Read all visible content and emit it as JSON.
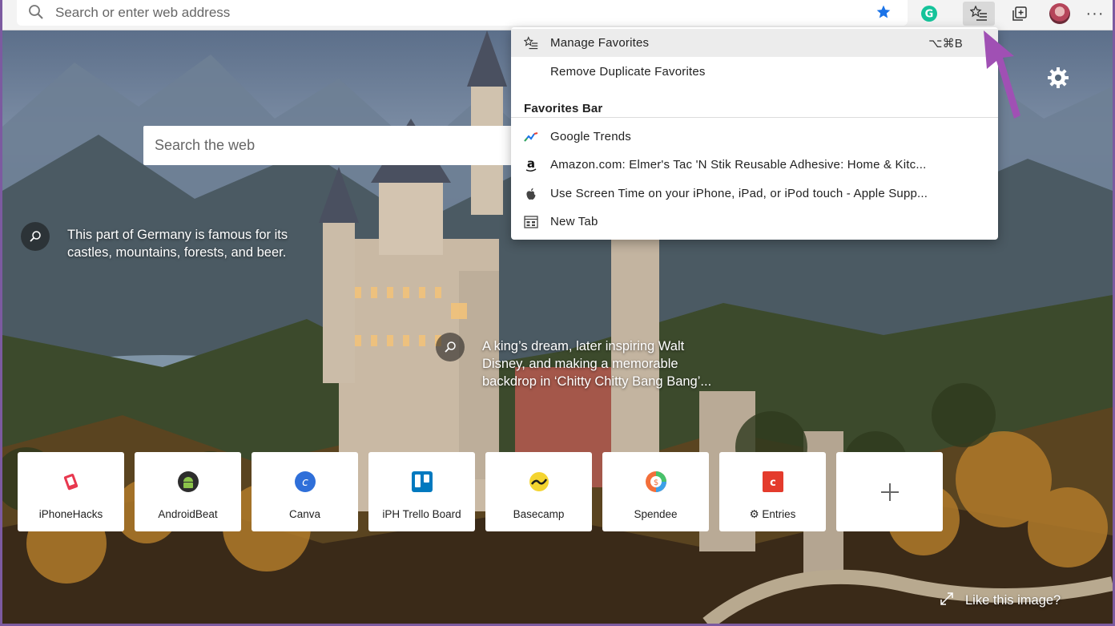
{
  "address_bar": {
    "placeholder": "Search or enter web address"
  },
  "toolbar": {
    "favorite_star_icon": "star-icon",
    "extension_icon": "grammarly-icon",
    "favorites_icon": "favorites-list-icon",
    "collections_icon": "collections-icon",
    "profile_icon": "avatar",
    "more_label": "···"
  },
  "favorites_menu": {
    "manage": {
      "label": "Manage Favorites",
      "shortcut": "⌥⌘B",
      "icon": "favorites-list-icon"
    },
    "remove_duplicates": {
      "label": "Remove Duplicate Favorites"
    },
    "section_title": "Favorites Bar",
    "items": [
      {
        "label": "Google Trends",
        "icon": "trends-icon"
      },
      {
        "label": "Amazon.com: Elmer's Tac 'N Stik Reusable Adhesive: Home & Kitc...",
        "icon": "amazon-icon"
      },
      {
        "label": "Use Screen Time on your iPhone, iPad, or iPod touch - Apple Supp...",
        "icon": "apple-icon"
      },
      {
        "label": "New Tab",
        "icon": "new-tab-icon"
      }
    ]
  },
  "page": {
    "search_placeholder": "Search the web",
    "info1": {
      "line1": "This part of Germany is famous for its",
      "line2": "castles, mountains, forests, and beer."
    },
    "info2": {
      "line1": "A king’s dream, later inspiring Walt",
      "line2": "Disney, and making a memorable",
      "line3": "backdrop in ‘Chitty Chitty Bang Bang’..."
    },
    "like_image": "Like this image?"
  },
  "tiles": [
    {
      "label": "iPhoneHacks",
      "color": "#e8384f"
    },
    {
      "label": "AndroidBeat",
      "color": "#3c3c3c"
    },
    {
      "label": "Canva",
      "color": "#2f6fd9"
    },
    {
      "label": "iPH Trello Board",
      "color": "#0079bf"
    },
    {
      "label": "Basecamp",
      "color": "#f4d430"
    },
    {
      "label": "Spendee",
      "color": "#f36f3a"
    },
    {
      "label": "⚙ Entries",
      "color": "#e43b2c"
    },
    {
      "label": "",
      "color": "#666666"
    }
  ],
  "colors": {
    "accent": "#1a73e8",
    "annotation_arrow": "#a050b4",
    "frame": "#7c5aa0"
  }
}
